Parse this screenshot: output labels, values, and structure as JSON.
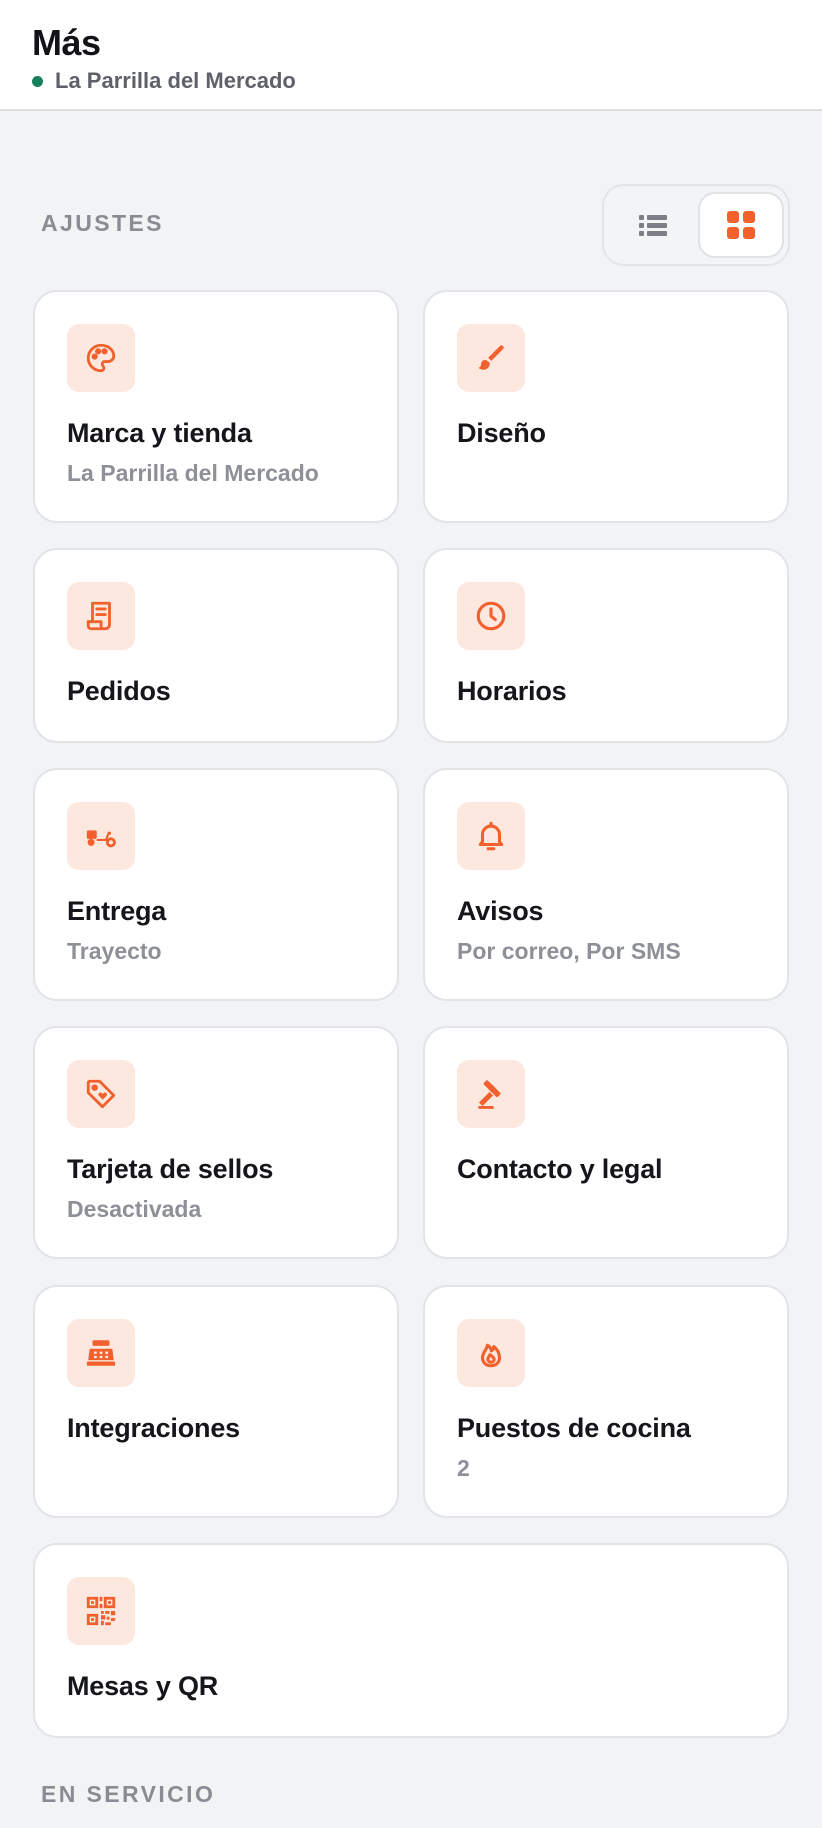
{
  "header": {
    "title": "Más",
    "store_name": "La Parrilla del Mercado"
  },
  "colors": {
    "accent": "#f2602d",
    "icon_bg": "#fde8df",
    "status_dot": "#17805a",
    "page_bg": "#f2f3f5"
  },
  "sections": {
    "settings_label": "AJUSTES",
    "in_service_label": "EN SERVICIO"
  },
  "view_toggle": {
    "options": [
      "list",
      "grid"
    ],
    "selected": "grid"
  },
  "cards": [
    {
      "title": "Marca y tienda",
      "subtitle": "La Parrilla del Mercado",
      "icon": "palette-icon"
    },
    {
      "title": "Diseño",
      "subtitle": "",
      "icon": "brush-icon"
    },
    {
      "title": "Pedidos",
      "subtitle": "",
      "icon": "receipt-icon"
    },
    {
      "title": "Horarios",
      "subtitle": "",
      "icon": "clock-icon"
    },
    {
      "title": "Entrega",
      "subtitle": "Trayecto",
      "icon": "scooter-icon"
    },
    {
      "title": "Avisos",
      "subtitle": "Por correo, Por SMS",
      "icon": "bell-icon"
    },
    {
      "title": "Tarjeta de sellos",
      "subtitle": "Desactivada",
      "icon": "tag-heart-icon"
    },
    {
      "title": "Contacto y legal",
      "subtitle": "",
      "icon": "gavel-icon"
    },
    {
      "title": "Integraciones",
      "subtitle": "",
      "icon": "cash-register-icon"
    },
    {
      "title": "Puestos de cocina",
      "subtitle": "2",
      "icon": "flame-icon"
    },
    {
      "title": "Mesas y QR",
      "subtitle": "",
      "icon": "qr-code-icon"
    }
  ]
}
